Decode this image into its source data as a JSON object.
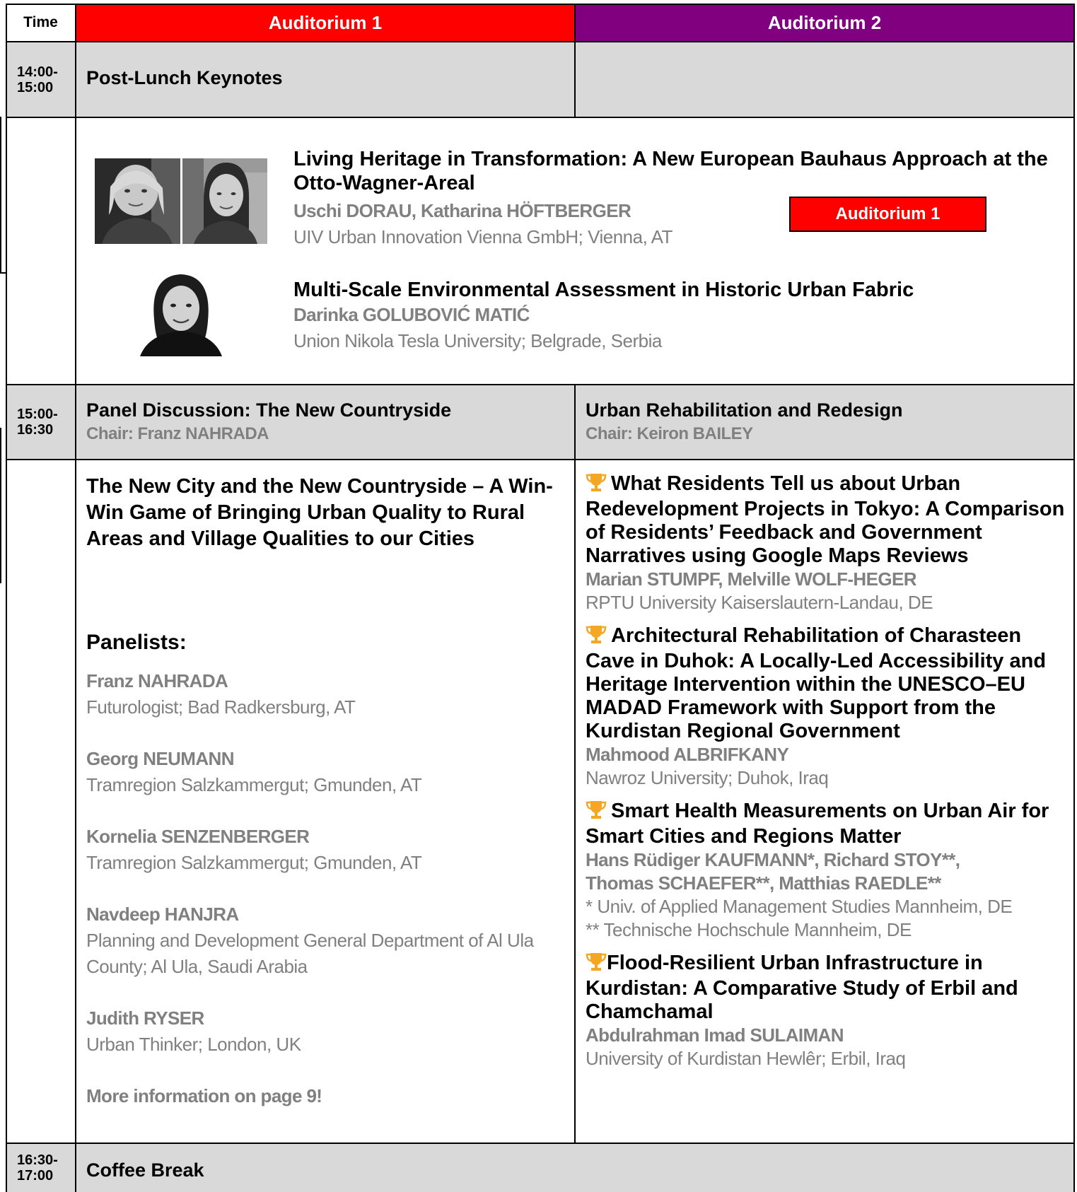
{
  "header": {
    "time_label": "Time",
    "aud1_label": "Auditorium 1",
    "aud2_label": "Auditorium 2"
  },
  "colors": {
    "aud1": "#ff0000",
    "aud2": "#800080",
    "session_bg": "#d9d9d9",
    "author_gray": "#808080",
    "trophy": "#f5a623"
  },
  "slots": {
    "s1_time": "14:00-\n15:00",
    "s2_time": "15:00-\n16:30",
    "s3_time": "16:30-\n17:00"
  },
  "keynotes": {
    "session_title": "Post-Lunch Keynotes",
    "room_badge": "Auditorium 1",
    "talks": [
      {
        "title": "Living Heritage in Transformation: A New European Bauhaus Approach at the Otto-Wagner-Areal",
        "authors": "Uschi DORAU, Katharina HÖFTBERGER",
        "affiliation": "UIV Urban Innovation Vienna GmbH; Vienna, AT"
      },
      {
        "title": "Multi-Scale Environmental Assessment in Historic Urban Fabric",
        "authors": "Darinka GOLUBOVIĆ MATIĆ",
        "affiliation": "Union Nikola Tesla University; Belgrade, Serbia"
      }
    ]
  },
  "panel": {
    "session_title": "Panel Discussion: The New Countryside",
    "chair": "Chair: Franz NAHRADA",
    "title": "The New City and the New Countryside – A Win-Win Game of Bringing Urban Quality to Rural Areas and Village Qualities to our Cities",
    "panelists_heading": "Panelists:",
    "panelists": [
      {
        "name": "Franz NAHRADA",
        "affiliation": "Futurologist; Bad Radkersburg, AT"
      },
      {
        "name": "Georg NEUMANN",
        "affiliation": "Tramregion Salzkammergut; Gmunden, AT"
      },
      {
        "name": "Kornelia SENZENBERGER",
        "affiliation": "Tramregion Salzkammergut; Gmunden, AT"
      },
      {
        "name": "Navdeep HANJRA",
        "affiliation": "Planning and Development General Department of Al Ula County; Al Ula, Saudi Arabia"
      },
      {
        "name": "Judith RYSER",
        "affiliation": "Urban Thinker; London, UK"
      }
    ],
    "more_info": "More information on page 9!"
  },
  "rehab": {
    "session_title": "Urban Rehabilitation and Redesign",
    "chair": "Chair: Keiron BAILEY",
    "papers": [
      {
        "title": "What Residents Tell us about Urban Redevelopment Projects in Tokyo: A Comparison of Residents’ Feedback and Government Narratives using Google Maps Reviews",
        "authors": "Marian STUMPF, Melville WOLF-HEGER",
        "affiliation": "RPTU University Kaiserslautern-Landau, DE"
      },
      {
        "title": "Architectural Rehabilitation of Charasteen Cave in Duhok: A Locally-Led Accessibility and Heritage Intervention within the UNESCO–EU MADAD Framework with Support from the Kurdistan Regional Government",
        "authors": "Mahmood ALBRIFKANY",
        "affiliation": "Nawroz University; Duhok, Iraq"
      },
      {
        "title": "Smart Health Measurements on Urban Air for Smart Cities and Regions Matter",
        "authors_line1": "Hans Rüdiger KAUFMANN*, Richard STOY**,",
        "authors_line2": "Thomas SCHAEFER**, Matthias RAEDLE**",
        "affiliation_line1": "* Univ. of Applied Management Studies Mannheim, DE",
        "affiliation_line2": "** Technische Hochschule Mannheim, DE"
      },
      {
        "title": "Flood-Resilient Urban Infrastructure in Kurdistan: A Comparative Study of Erbil and Chamchamal",
        "authors": "Abdulrahman Imad SULAIMAN",
        "affiliation": "University of Kurdistan Hewlêr; Erbil, Iraq"
      }
    ]
  },
  "coffee": {
    "session_title": "Coffee Break"
  }
}
